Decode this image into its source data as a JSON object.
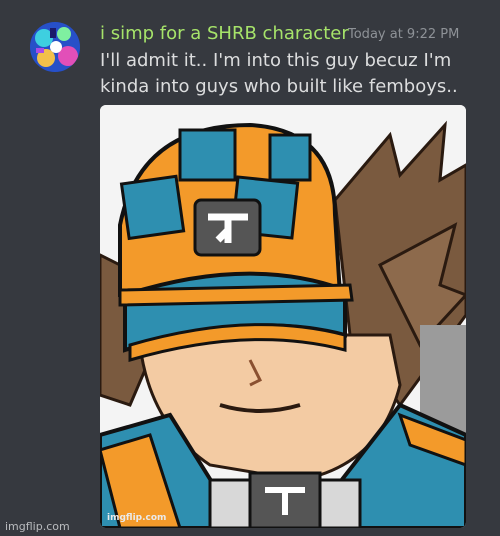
{
  "message": {
    "author": "i simp for a SHRB character",
    "timestamp": "Today at 9:22 PM",
    "lines": [
      "I'll admit it.. I'm into this guy becuz I'm",
      "kinda into guys who built like femboys.."
    ]
  },
  "attachment": {
    "watermark": "imgflip.com"
  },
  "page_watermark": "imgflip.com",
  "colors": {
    "background": "#36393f",
    "username": "#a6e36a",
    "text": "#dcddde",
    "timestamp": "#8e9297"
  }
}
